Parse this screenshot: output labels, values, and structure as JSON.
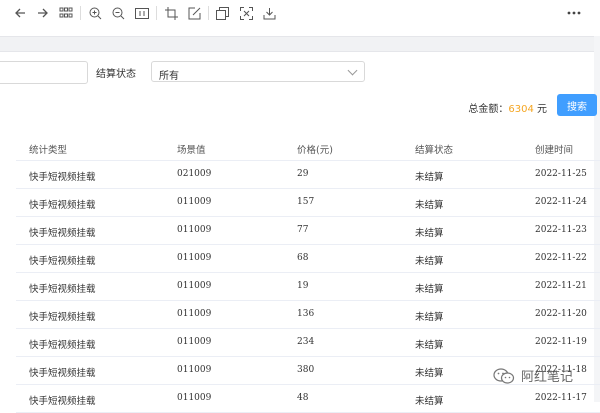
{
  "toolbar": {
    "icons": [
      "back-icon",
      "forward-icon",
      "grid-icon",
      "zoom-in-icon",
      "zoom-out-icon",
      "fit-icon",
      "crop-icon",
      "edit-icon",
      "copy-icon",
      "scan-icon",
      "download-icon",
      "more-icon"
    ]
  },
  "filters": {
    "settle_status_label": "结算状态",
    "settle_status_value": "所有"
  },
  "summary": {
    "total_label": "总金额：",
    "total_amount": "6304",
    "currency": "元",
    "search_label": "搜索"
  },
  "table": {
    "headers": [
      "统计类型",
      "场景值",
      "价格(元)",
      "结算状态",
      "创建时间"
    ],
    "rows": [
      [
        "快手短视频挂载",
        "021009",
        "29",
        "未结算",
        "2022-11-25"
      ],
      [
        "快手短视频挂载",
        "011009",
        "157",
        "未结算",
        "2022-11-24"
      ],
      [
        "快手短视频挂载",
        "011009",
        "77",
        "未结算",
        "2022-11-23"
      ],
      [
        "快手短视频挂载",
        "011009",
        "68",
        "未结算",
        "2022-11-22"
      ],
      [
        "快手短视频挂载",
        "011009",
        "19",
        "未结算",
        "2022-11-21"
      ],
      [
        "快手短视频挂载",
        "011009",
        "136",
        "未结算",
        "2022-11-20"
      ],
      [
        "快手短视频挂载",
        "011009",
        "234",
        "未结算",
        "2022-11-19"
      ],
      [
        "快手短视频挂载",
        "011009",
        "380",
        "未结算",
        "2022-11-18"
      ],
      [
        "快手短视频挂载",
        "011009",
        "48",
        "未结算",
        "2022-11-17"
      ]
    ]
  },
  "watermark": {
    "text": "阿红笔记"
  },
  "colors": {
    "accent": "#409eff",
    "amount": "#f5a623"
  }
}
